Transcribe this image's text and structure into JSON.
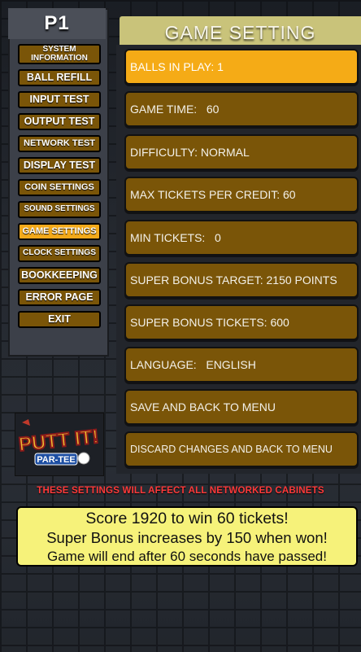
{
  "player": "P1",
  "title": "GAME SETTING",
  "menu": [
    {
      "label": "SYSTEM INFORMATION",
      "active": false
    },
    {
      "label": "BALL REFILL",
      "active": false
    },
    {
      "label": "INPUT TEST",
      "active": false
    },
    {
      "label": "OUTPUT TEST",
      "active": false
    },
    {
      "label": "NETWORK TEST",
      "active": false
    },
    {
      "label": "DISPLAY TEST",
      "active": false
    },
    {
      "label": "COIN SETTINGS",
      "active": false
    },
    {
      "label": "SOUND SETTINGS",
      "active": false
    },
    {
      "label": "GAME SETTINGS",
      "active": true
    },
    {
      "label": "CLOCK SETTINGS",
      "active": false
    },
    {
      "label": "BOOKKEEPING",
      "active": false
    },
    {
      "label": "ERROR PAGE",
      "active": false
    },
    {
      "label": "EXIT",
      "active": false
    }
  ],
  "logo": {
    "line1": "PUTT IT!",
    "line2": "PAR-TEE"
  },
  "settings": [
    {
      "label": "BALLS IN PLAY: ",
      "value": "1",
      "active": true
    },
    {
      "label": "GAME TIME:   ",
      "value": "60",
      "active": false
    },
    {
      "label": "DIFFICULTY: ",
      "value": "NORMAL",
      "active": false
    },
    {
      "label": "MAX TICKETS PER CREDIT: ",
      "value": "60",
      "active": false
    },
    {
      "label": "MIN TICKETS:   ",
      "value": "0",
      "active": false
    },
    {
      "label": "SUPER BONUS TARGET: ",
      "value": "2150 POINTS",
      "active": false
    },
    {
      "label": "SUPER BONUS TICKETS: ",
      "value": "600",
      "active": false
    },
    {
      "label": "LANGUAGE:   ",
      "value": "ENGLISH",
      "active": false
    },
    {
      "label": "SAVE AND BACK TO MENU",
      "value": "",
      "active": false
    },
    {
      "label": "DISCARD CHANGES AND BACK TO MENU",
      "value": "",
      "active": false
    }
  ],
  "warning": "THESE SETTINGS WILL AFFECT ALL NETWORKED CABINETS",
  "info": [
    "Score 1920 to win 60 tickets!",
    "Super Bonus increases by 150 when won!",
    "Game will end after 60 seconds have passed!"
  ],
  "colors": {
    "button": "#7a5508",
    "active": "#f5ab16",
    "warning": "#ff3a3a",
    "info_bg": "#f6f27a",
    "title_bg": "#c9c37a"
  }
}
